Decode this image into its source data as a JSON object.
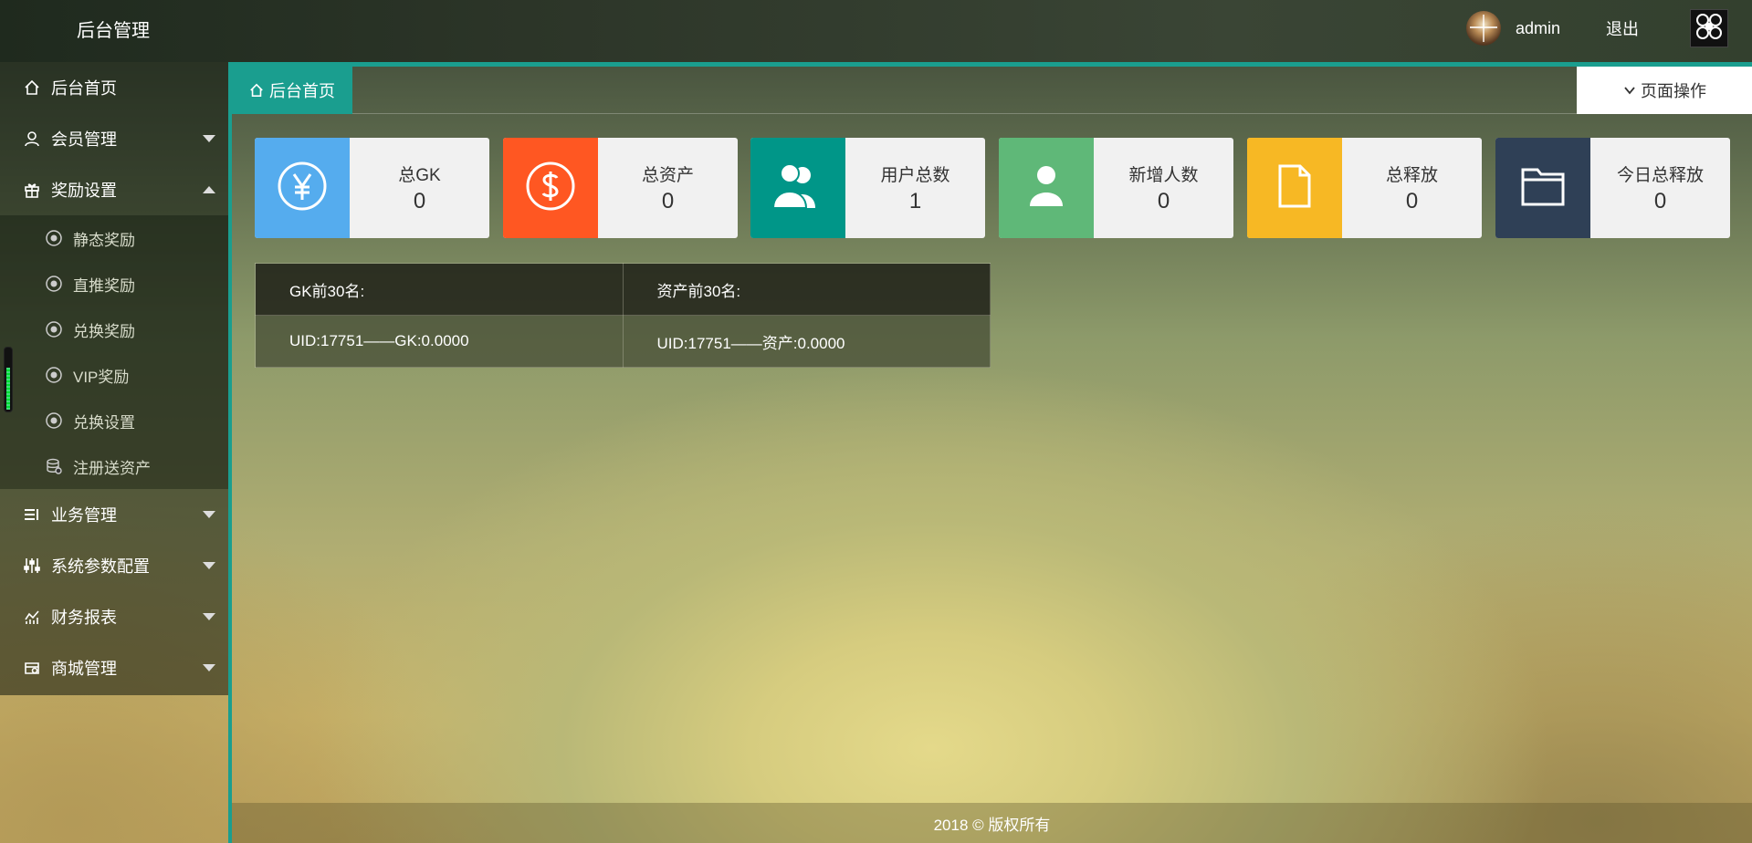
{
  "header": {
    "brand": "后台管理",
    "username": "admin",
    "logout_label": "退出"
  },
  "sidebar": {
    "items": [
      {
        "label": "后台首页",
        "icon": "home-icon"
      },
      {
        "label": "会员管理",
        "icon": "user-icon"
      },
      {
        "label": "奖励设置",
        "icon": "gift-icon",
        "expanded": true,
        "children": [
          {
            "label": "静态奖励",
            "icon": "gear-icon"
          },
          {
            "label": "直推奖励",
            "icon": "gear-icon"
          },
          {
            "label": "兑换奖励",
            "icon": "gear-icon"
          },
          {
            "label": "VIP奖励",
            "icon": "gear-icon"
          },
          {
            "label": "兑换设置",
            "icon": "gear-icon"
          },
          {
            "label": "注册送资产",
            "icon": "database-icon"
          }
        ]
      },
      {
        "label": "业务管理",
        "icon": "list-icon"
      },
      {
        "label": "系统参数配置",
        "icon": "sliders-icon"
      },
      {
        "label": "财务报表",
        "icon": "chart-icon"
      },
      {
        "label": "商城管理",
        "icon": "shop-icon"
      }
    ]
  },
  "tabs": {
    "home_label": "后台首页",
    "page_ops_label": "页面操作"
  },
  "cards": [
    {
      "label": "总GK",
      "value": "0",
      "icon": "yen-icon",
      "color": "#55acee"
    },
    {
      "label": "总资产",
      "value": "0",
      "icon": "dollar-icon",
      "color": "#ff5722"
    },
    {
      "label": "用户总数",
      "value": "1",
      "icon": "users-icon",
      "color": "#009688"
    },
    {
      "label": "新增人数",
      "value": "0",
      "icon": "user-add-icon",
      "color": "#5fb878"
    },
    {
      "label": "总释放",
      "value": "0",
      "icon": "file-icon",
      "color": "#f7b824"
    },
    {
      "label": "今日总释放",
      "value": "0",
      "icon": "folder-icon",
      "color": "#2f4056"
    }
  ],
  "rank_table": {
    "headers": [
      "GK前30名:",
      "资产前30名:"
    ],
    "rows": [
      [
        "UID:17751——GK:0.0000",
        "UID:17751——资产:0.0000"
      ]
    ]
  },
  "footer": {
    "text": "2018 © 版权所有"
  }
}
